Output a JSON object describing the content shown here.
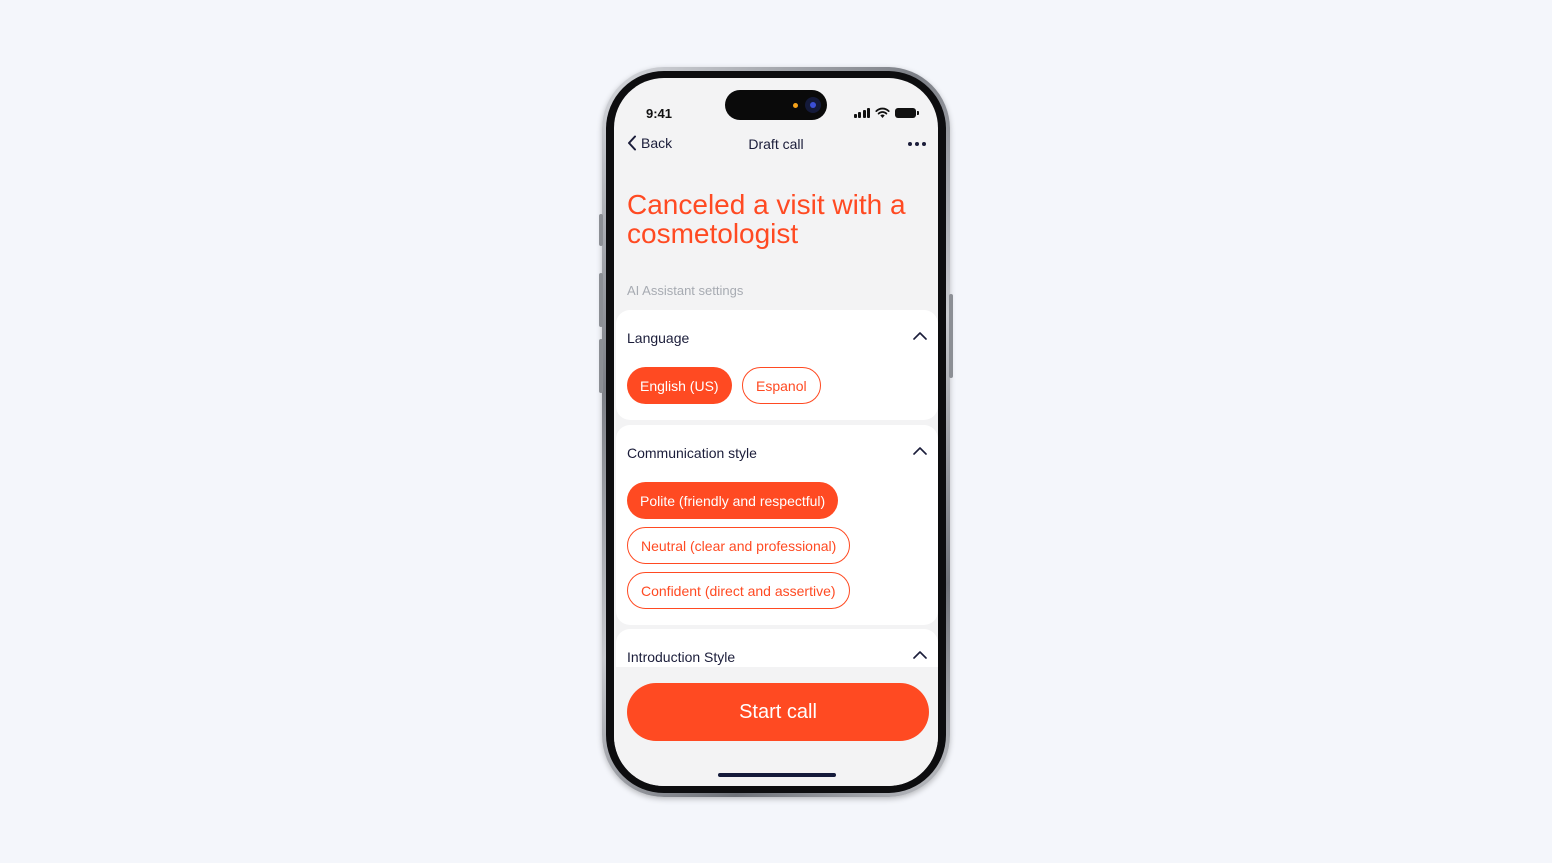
{
  "status": {
    "time": "9:41"
  },
  "nav": {
    "back_label": "Back",
    "title": "Draft call"
  },
  "headline": "Canceled a visit with a cosmetologist",
  "section_label": "AI Assistant settings",
  "language": {
    "title": "Language",
    "options": [
      {
        "label": "English (US)",
        "selected": true
      },
      {
        "label": "Espanol",
        "selected": false
      }
    ]
  },
  "communication": {
    "title": "Communication style",
    "options": [
      {
        "label": "Polite (friendly and respectful)",
        "selected": true
      },
      {
        "label": "Neutral (clear and professional)",
        "selected": false
      },
      {
        "label": "Confident (direct and assertive)",
        "selected": false
      }
    ]
  },
  "introduction": {
    "title": "Introduction Style"
  },
  "start_button": "Start call",
  "colors": {
    "accent": "#ff4a22",
    "text_dark": "#1b1d3a",
    "muted": "#a7abb2",
    "background": "#f3f3f4"
  },
  "icons": [
    "chevron-left-icon",
    "more-icon",
    "chevron-up-icon",
    "signal-icon",
    "wifi-icon",
    "battery-icon"
  ]
}
